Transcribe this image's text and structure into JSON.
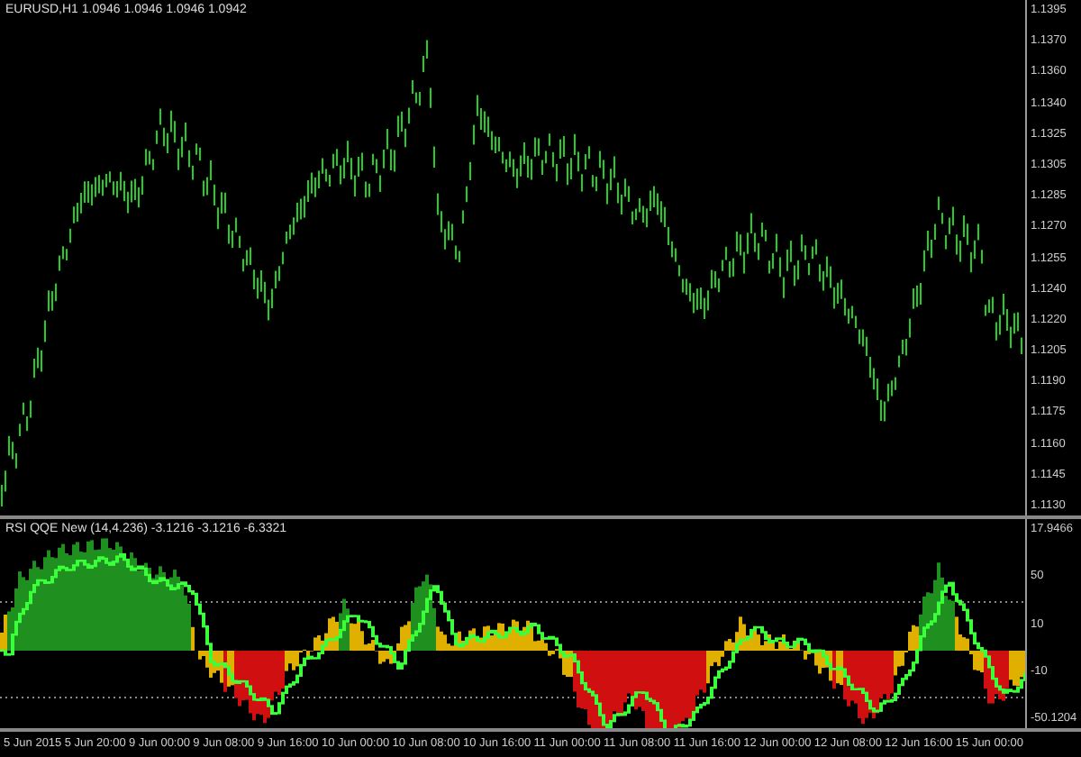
{
  "main_chart": {
    "title": "EURUSD,H1 1.0946 1.0946 1.0946 1.0942",
    "price_axis": [
      "1.1395",
      "1.1370",
      "1.1360",
      "1.1340",
      "1.1325",
      "1.1305",
      "1.1285",
      "1.1270",
      "1.1255",
      "1.1240",
      "1.1220",
      "1.1205",
      "1.1190",
      "1.1175",
      "1.1160",
      "1.1145",
      "1.1130"
    ]
  },
  "indicator": {
    "title": "RSI QQE New (14,4.236) -3.1216 -3.1216 -6.3321",
    "axis": [
      "17.9466",
      "50",
      "10",
      "-10",
      "-50.1204"
    ]
  },
  "time_axis": [
    "5 Jun 2015",
    "5 Jun 20:00",
    "9 Jun 00:00",
    "9 Jun 08:00",
    "9 Jun 16:00",
    "10 Jun 00:00",
    "10 Jun 08:00",
    "10 Jun 16:00",
    "11 Jun 00:00",
    "11 Jun 08:00",
    "11 Jun 16:00",
    "12 Jun 00:00",
    "12 Jun 08:00",
    "12 Jun 16:00",
    "15 Jun 00:00"
  ]
}
